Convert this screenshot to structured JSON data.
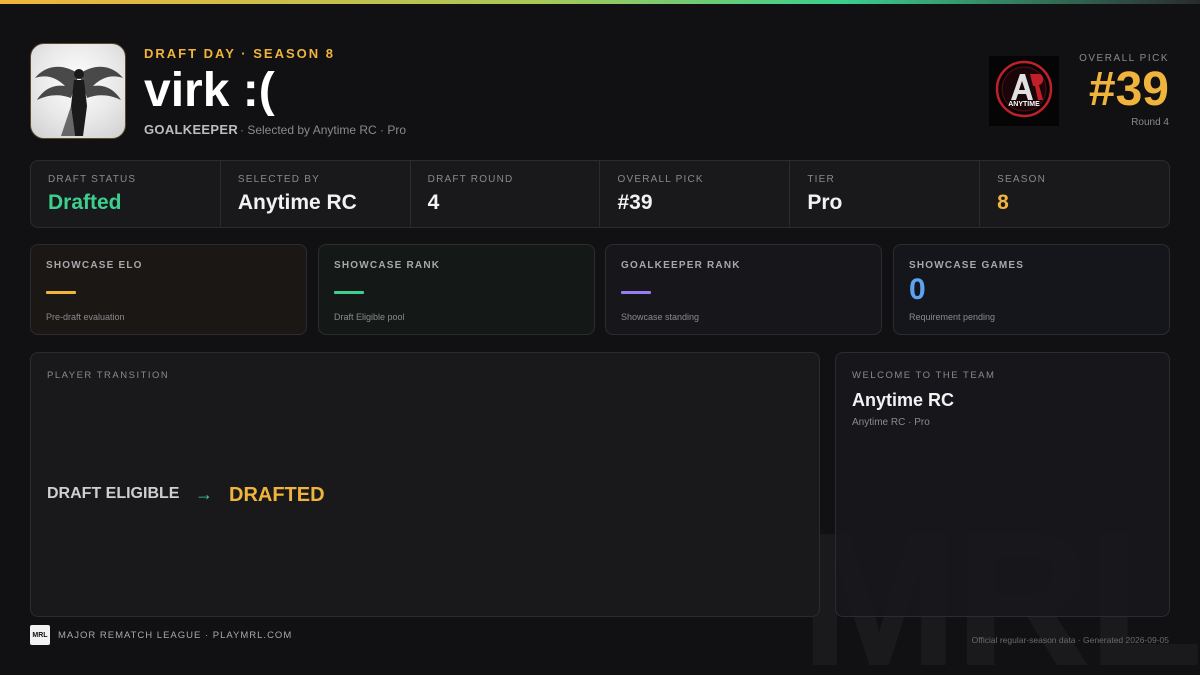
{
  "header": {
    "eyebrow": "DRAFT DAY · SEASON 8",
    "player_name": "virk :(",
    "position": "GOALKEEPER",
    "selected_meta": "· Selected by Anytime RC · Pro",
    "avatar_icon": "winged-figure-avatar"
  },
  "team_logo": {
    "icon": "anytime-rc-logo",
    "text": "ANYTIME"
  },
  "overall_pick": {
    "label": "OVERALL PICK",
    "number": "#39",
    "round": "Round 4"
  },
  "stats": [
    {
      "label": "DRAFT STATUS",
      "value": "Drafted",
      "color": "#3ccf8e"
    },
    {
      "label": "SELECTED BY",
      "value": "Anytime RC",
      "color": "#f2f2f2"
    },
    {
      "label": "DRAFT ROUND",
      "value": "4",
      "color": "#f2f2f2"
    },
    {
      "label": "OVERALL PICK",
      "value": "#39",
      "color": "#f2f2f2"
    },
    {
      "label": "TIER",
      "value": "Pro",
      "color": "#f2f2f2"
    },
    {
      "label": "SEASON",
      "value": "8",
      "color": "#f0b43c"
    }
  ],
  "cards": [
    {
      "label": "SHOWCASE ELO",
      "value": "",
      "note": "Pre-draft evaluation",
      "accent": "#f0b43c"
    },
    {
      "label": "SHOWCASE RANK",
      "value": "",
      "note": "Draft Eligible pool",
      "accent": "#3ccf8e"
    },
    {
      "label": "GOALKEEPER RANK",
      "value": "",
      "note": "Showcase standing",
      "accent": "#9b7bf0"
    },
    {
      "label": "SHOWCASE GAMES",
      "value": "0",
      "note": "Requirement pending",
      "accent": "#5ea3f2"
    }
  ],
  "transition": {
    "label": "PLAYER TRANSITION",
    "from": "DRAFT ELIGIBLE",
    "arrow_icon": "arrow-right-icon",
    "to": "DRAFTED"
  },
  "welcome": {
    "label": "WELCOME TO THE TEAM",
    "team": "Anytime RC",
    "meta": "Anytime RC · Pro"
  },
  "footer": {
    "logo_text": "MRL",
    "league": "MAJOR REMATCH LEAGUE · PLAYMRL.COM",
    "meta": "Official regular-season data · Generated 2026-09-05",
    "watermark": "MRL"
  }
}
